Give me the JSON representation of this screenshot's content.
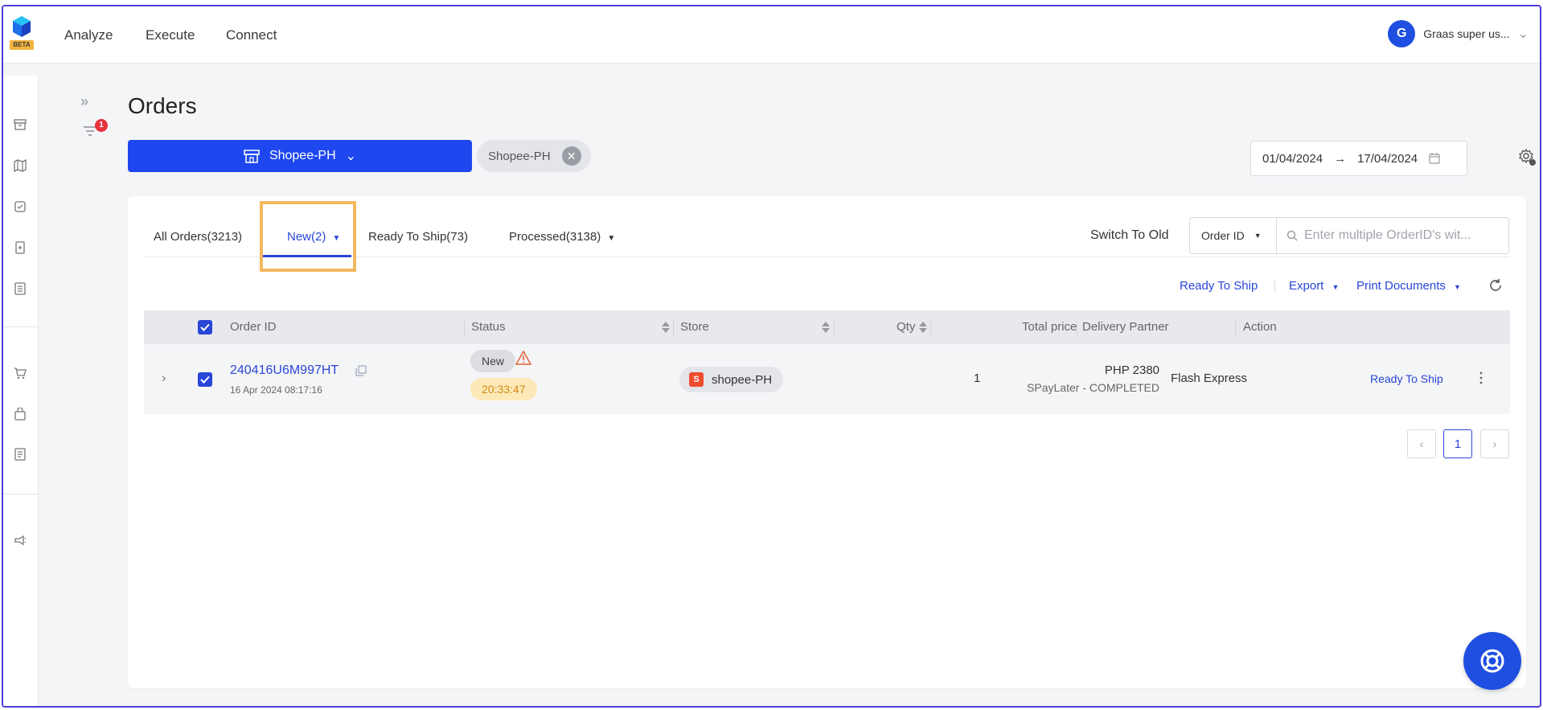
{
  "nav": {
    "beta_label": "BETA",
    "items": [
      {
        "label": "Analyze"
      },
      {
        "label": "Execute"
      },
      {
        "label": "Connect"
      }
    ],
    "user": {
      "initial": "G",
      "name": "Graas super us..."
    }
  },
  "page": {
    "title": "Orders",
    "filter_count": "1",
    "store_selector_label": "Shopee-PH",
    "store_chip_label": "Shopee-PH",
    "date_range": {
      "start": "01/04/2024",
      "arrow": "→",
      "end": "17/04/2024"
    }
  },
  "tabs": [
    {
      "label": "All Orders(3213)"
    },
    {
      "label": "New(2)"
    },
    {
      "label": "Ready To Ship(73)"
    },
    {
      "label": "Processed(3138)"
    }
  ],
  "toolbar": {
    "switch_old": "Switch To Old",
    "search_field": "Order ID",
    "search_placeholder": "Enter multiple OrderID's wit...",
    "ready_to_ship": "Ready To Ship",
    "export": "Export",
    "print_documents": "Print Documents"
  },
  "table": {
    "columns": {
      "order_id": "Order ID",
      "status": "Status",
      "store": "Store",
      "qty": "Qty",
      "total_price": "Total price",
      "delivery_partner": "Delivery Partner",
      "action": "Action"
    },
    "rows": [
      {
        "order_id": "240416U6M997HT",
        "date": "16 Apr 2024 08:17:16",
        "status": "New",
        "timer": "20:33:47",
        "store": "shopee-PH",
        "qty": "1",
        "price": "PHP 2380",
        "payment": "SPayLater - COMPLETED",
        "delivery_partner": "Flash Express",
        "action": "Ready To Ship"
      }
    ]
  },
  "pagination": {
    "current": "1"
  },
  "colors": {
    "primary": "#1f47f0",
    "link": "#2946d6",
    "highlight": "#f4b860",
    "badge": "#e8323c",
    "shopee": "#ee4d2d"
  }
}
